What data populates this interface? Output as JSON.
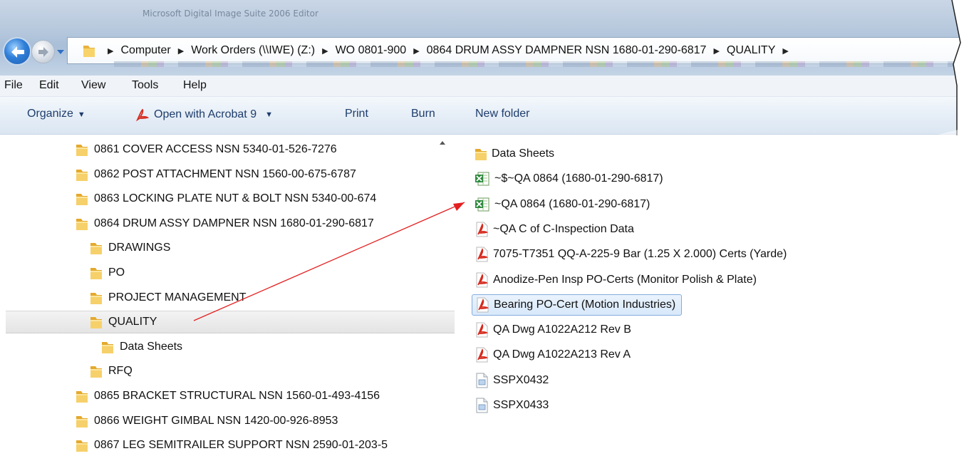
{
  "window": {
    "title": "Microsoft Digital Image Suite 2006 Editor"
  },
  "address_bar": {
    "crumbs": [
      "Computer",
      "Work Orders (\\\\IWE) (Z:)",
      "WO 0801-900",
      "0864 DRUM ASSY DAMPNER NSN 1680-01-290-6817",
      "QUALITY"
    ]
  },
  "menu": {
    "items": [
      "File",
      "Edit",
      "View",
      "Tools",
      "Help"
    ]
  },
  "toolbar": {
    "organize": "Organize",
    "open_with": "Open with Acrobat 9",
    "print": "Print",
    "burn": "Burn",
    "new_folder": "New folder"
  },
  "nav_tree": {
    "items": [
      {
        "label": "0861 COVER ACCESS NSN 5340-01-526-7276",
        "level": 0
      },
      {
        "label": "0862 POST ATTACHMENT NSN 1560-00-675-6787",
        "level": 0
      },
      {
        "label": "0863 LOCKING PLATE NUT & BOLT NSN 5340-00-674",
        "level": 0
      },
      {
        "label": "0864 DRUM ASSY DAMPNER NSN 1680-01-290-6817",
        "level": 0
      },
      {
        "label": "DRAWINGS",
        "level": 1
      },
      {
        "label": "PO",
        "level": 1
      },
      {
        "label": "PROJECT MANAGEMENT",
        "level": 1
      },
      {
        "label": "QUALITY",
        "level": 1,
        "selected": true
      },
      {
        "label": "Data Sheets",
        "level": 2
      },
      {
        "label": "RFQ",
        "level": 1
      },
      {
        "label": "0865 BRACKET STRUCTURAL NSN 1560-01-493-4156",
        "level": 0
      },
      {
        "label": "0866 WEIGHT GIMBAL NSN 1420-00-926-8953",
        "level": 0
      },
      {
        "label": "0867 LEG SEMITRAILER SUPPORT NSN 2590-01-203-5",
        "level": 0
      }
    ]
  },
  "files": [
    {
      "label": "Data Sheets",
      "icon": "folder"
    },
    {
      "label": "~$~QA 0864 (1680-01-290-6817)",
      "icon": "excel"
    },
    {
      "label": "~QA 0864 (1680-01-290-6817)",
      "icon": "excel"
    },
    {
      "label": "~QA C of C-Inspection Data",
      "icon": "pdf"
    },
    {
      "label": "7075-T7351 QQ-A-225-9 Bar (1.25 X 2.000) Certs (Yarde)",
      "icon": "pdf"
    },
    {
      "label": "Anodize-Pen Insp PO-Certs (Monitor Polish & Plate)",
      "icon": "pdf"
    },
    {
      "label": "Bearing PO-Cert (Motion Industries)",
      "icon": "pdf",
      "selected": true
    },
    {
      "label": "QA Dwg A1022A212 Rev B",
      "icon": "pdf"
    },
    {
      "label": "QA Dwg A1022A213 Rev A",
      "icon": "pdf"
    },
    {
      "label": "SSPX0432",
      "icon": "generic"
    },
    {
      "label": "SSPX0433",
      "icon": "generic"
    }
  ],
  "colors": {
    "annotation_arrow": "#e32020",
    "selection": "#d8e9fb",
    "link_text": "#1e3d6b"
  }
}
